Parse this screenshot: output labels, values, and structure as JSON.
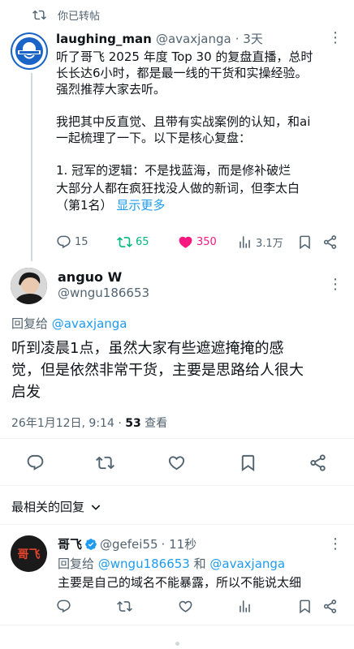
{
  "retweet_bar": {
    "label": "你已转帖"
  },
  "tweet1": {
    "name": "laughing_man",
    "handle": "@avaxjanga",
    "time": "· 3天",
    "lines": [
      "听了哥飞 2025 年度 Top 30 的复盘直播，总时",
      "长长达6小时，都是最一线的干货和实操经验。",
      "强烈推荐大家去听。",
      "",
      "我把其中反直觉、且带有实战案例的认知，和ai",
      "一起梳理了一下。以下是核心复盘：",
      "",
      "1. 冠军的逻辑：不是找蓝海，而是修补破烂",
      "大部分人都在疯狂找没人做的新词，但李太白",
      "（第1名）"
    ],
    "show_more": "显示更多",
    "replies": "15",
    "retweets": "65",
    "likes": "350",
    "views": "3.1万"
  },
  "tweet2": {
    "name": "anguo W",
    "handle": "@wngu186653",
    "reply_to_prefix": "回复给 ",
    "reply_to": "@avaxjanga",
    "lines": [
      "听到凌晨1点，虽然大家有些遮遮掩掩的感",
      "觉，但是依然非常干货，主要是思路给人很大",
      "启发"
    ],
    "date": "26年1月12日, 9:14 · ",
    "views_count": "53",
    "views_label": " 查看"
  },
  "replies_section": {
    "sort_label": "最相关的回复"
  },
  "reply1": {
    "name": "哥飞",
    "handle": "@gefei55",
    "time": "· 11秒",
    "avatar_text": "哥飞",
    "reply_to_prefix": "回复给 ",
    "reply_to_a": "@wngu186653",
    "reply_to_and": " 和 ",
    "reply_to_b": "@avaxjanga",
    "text": "主要是自己的域名不能暴露，所以不能说太细"
  },
  "colors": {
    "accent": "#1d9bf0",
    "retweet_green": "#00ba7c",
    "like_pink": "#f91880",
    "muted": "#536471"
  }
}
